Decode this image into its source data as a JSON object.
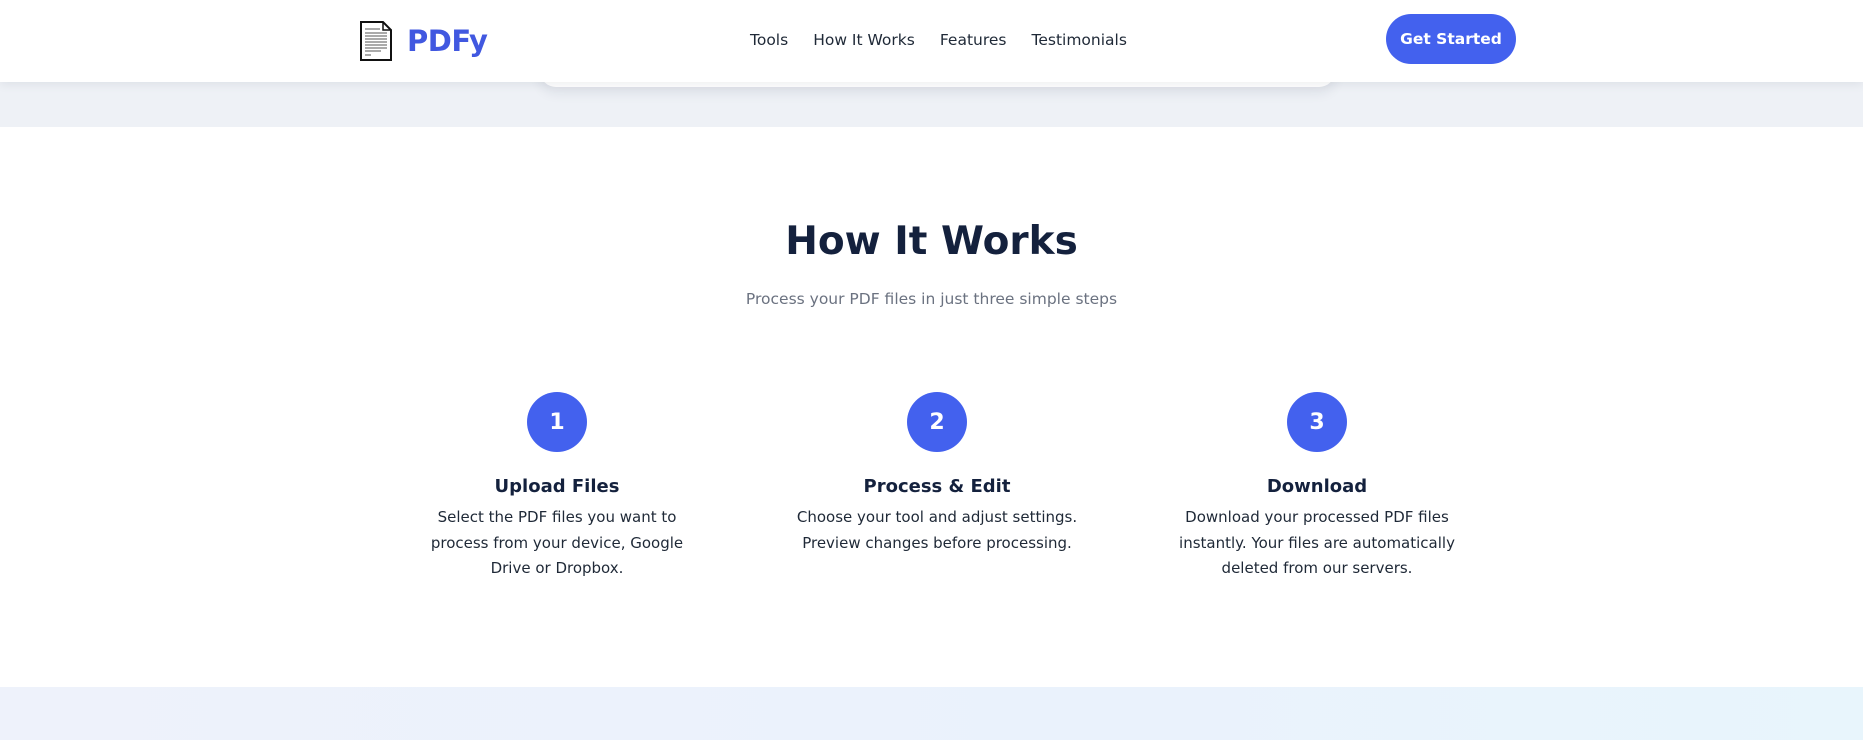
{
  "brand": {
    "name": "PDFy",
    "accent_color": "#4361ee",
    "icon": "document-icon"
  },
  "nav": {
    "items": [
      {
        "label": "Tools"
      },
      {
        "label": "How It Works"
      },
      {
        "label": "Features"
      },
      {
        "label": "Testimonials"
      }
    ],
    "cta_label": "Get Started"
  },
  "how_it_works": {
    "title": "How It Works",
    "subtitle": "Process your PDF files in just three simple steps",
    "steps": [
      {
        "number": "1",
        "title": "Upload Files",
        "description": "Select the PDF files you want to process from your device, Google Drive or Dropbox."
      },
      {
        "number": "2",
        "title": "Process & Edit",
        "description": "Choose your tool and adjust settings. Preview changes before processing."
      },
      {
        "number": "3",
        "title": "Download",
        "description": "Download your processed PDF files instantly. Your files are automatically deleted from our servers."
      }
    ]
  }
}
